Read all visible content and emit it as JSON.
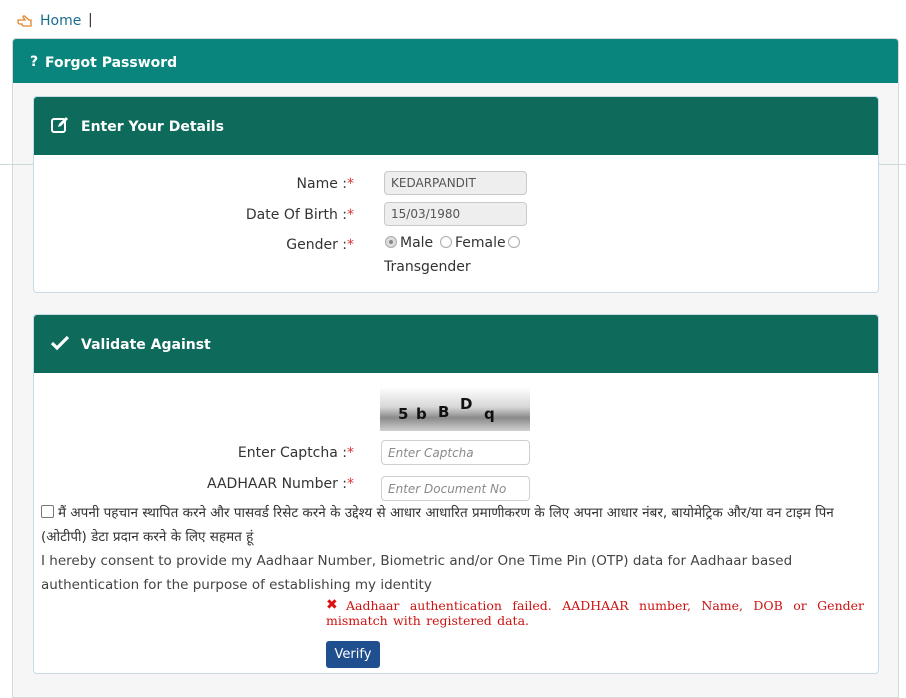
{
  "breadcrumb": {
    "home_label": "Home",
    "separator": "|"
  },
  "outer_panel": {
    "icon": "question-icon",
    "title": "Forgot Password"
  },
  "details_panel": {
    "title": "Enter Your Details",
    "icon": "edit-icon",
    "name_label": "Name :",
    "name_value": "KEDARPANDIT",
    "dob_label": "Date Of Birth :",
    "dob_value": "15/03/1980",
    "gender_label": "Gender :",
    "gender_options": [
      "Male",
      "Female",
      "Transgender"
    ],
    "gender_selected": "Male",
    "required_mark": "*"
  },
  "validate_panel": {
    "title": "Validate Against",
    "icon": "check-icon",
    "captcha_text": [
      "5",
      "b",
      "B",
      "D",
      "q"
    ],
    "captcha_label": "Enter Captcha :",
    "captcha_placeholder": "Enter Captcha",
    "aadhaar_label": "AADHAAR Number :",
    "aadhaar_placeholder": "Enter Document No",
    "consent_hindi": "मैं अपनी पहचान स्थापित करने और पासवर्ड रिसेट करने के उद्देश्य से आधार आधारित प्रमाणीकरण के लिए अपना आधार नंबर, बायोमेट्रिक और/या वन टाइम पिन (ओटीपी) डेटा प्रदान करने के लिए सहमत हूं",
    "consent_english": "I hereby consent to provide my Aadhaar Number, Biometric and/or One Time Pin (OTP) data for Aadhaar based authentication for the purpose of establishing my identity",
    "error_message_line1": "Aadhaar authentication failed. AADHAAR number, Name, DOB or Gender",
    "error_message_line2": "mismatch with registered data.",
    "verify_label": "Verify"
  },
  "colors": {
    "outer_header": "#09857d",
    "panel_header": "#0e6b5c",
    "verify_button": "#1f4f8f",
    "error": "#cc1111"
  }
}
